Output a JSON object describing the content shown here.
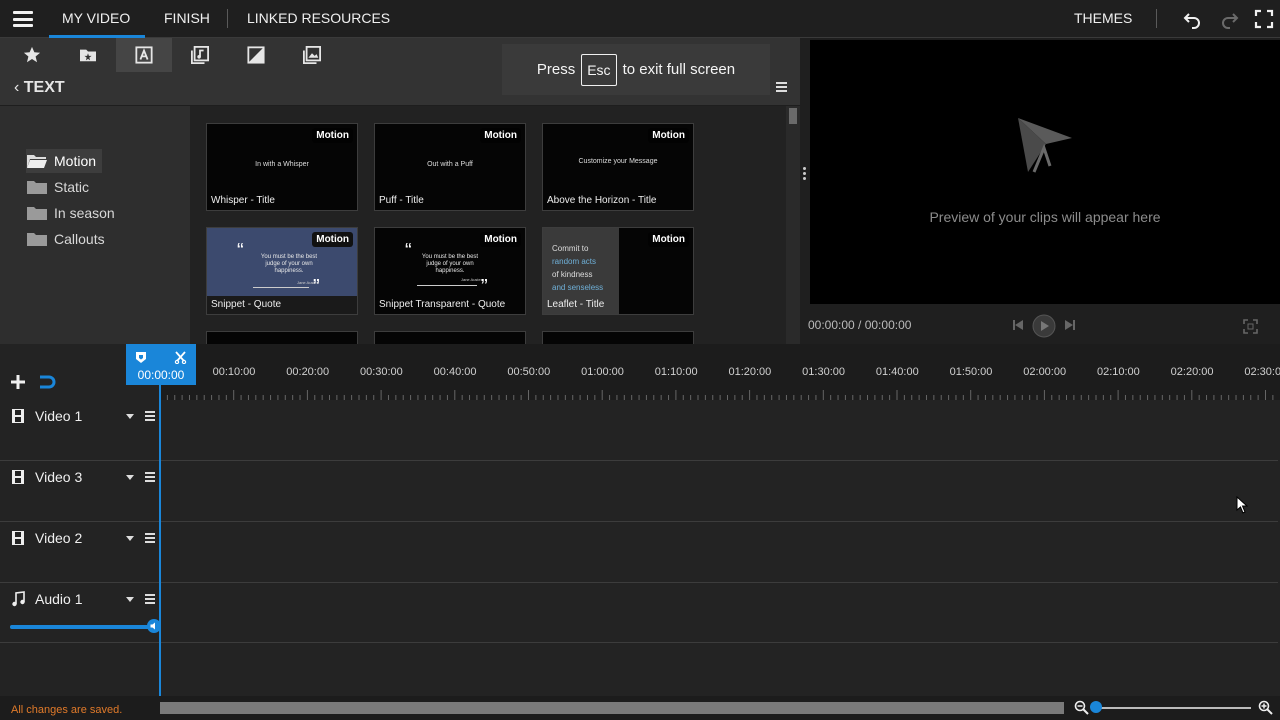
{
  "topbar": {
    "tabs": [
      "MY VIDEO",
      "FINISH",
      "LINKED RESOURCES"
    ],
    "active_tab": "MY VIDEO",
    "themes_label": "THEMES"
  },
  "media": {
    "section_title": "TEXT",
    "folders": [
      "Motion",
      "Static",
      "In season",
      "Callouts"
    ],
    "selected_folder": "Motion",
    "thumbnails": [
      {
        "badge": "Motion",
        "center": "In with a Whisper",
        "caption": "Whisper - Title"
      },
      {
        "badge": "Motion",
        "center": "Out with a Puff",
        "caption": "Puff - Title"
      },
      {
        "badge": "Motion",
        "center": "Customize your Message",
        "caption": "Above the Horizon - Title"
      },
      {
        "badge": "Motion",
        "quote": "You must be the best judge of your own happiness.",
        "author": "Jane Austen",
        "caption": "Snippet - Quote"
      },
      {
        "badge": "Motion",
        "quote": "You must be the best judge of your own happiness.",
        "author": "Jane Austen",
        "caption": "Snippet Transparent - Quote"
      },
      {
        "badge": "Motion",
        "lines": [
          "Commit to",
          "random acts",
          "of kindness",
          "and senseless"
        ],
        "caption": "Leaflet - Title"
      }
    ]
  },
  "esc_overlay": {
    "press": "Press",
    "key": "Esc",
    "rest": "to exit full screen"
  },
  "preview": {
    "message": "Preview of your clips will appear here",
    "time": "00:00:00 / 00:00:00"
  },
  "timeline": {
    "playhead_time": "00:00:00",
    "ticks": [
      "00:10:00",
      "00:20:00",
      "00:30:00",
      "00:40:00",
      "00:50:00",
      "01:00:00",
      "01:10:00",
      "01:20:00",
      "01:30:00",
      "01:40:00",
      "01:50:00",
      "02:00:00",
      "02:10:00",
      "02:20:00",
      "02:30:00"
    ],
    "tracks": [
      {
        "name": "Video 1",
        "type": "video"
      },
      {
        "name": "Video 3",
        "type": "video"
      },
      {
        "name": "Video 2",
        "type": "video"
      },
      {
        "name": "Audio 1",
        "type": "audio"
      }
    ],
    "audio_volume": 1.0
  },
  "status": {
    "saved_text": "All changes are saved."
  },
  "colors": {
    "accent": "#1a86d9",
    "saved": "#e07a2a"
  }
}
